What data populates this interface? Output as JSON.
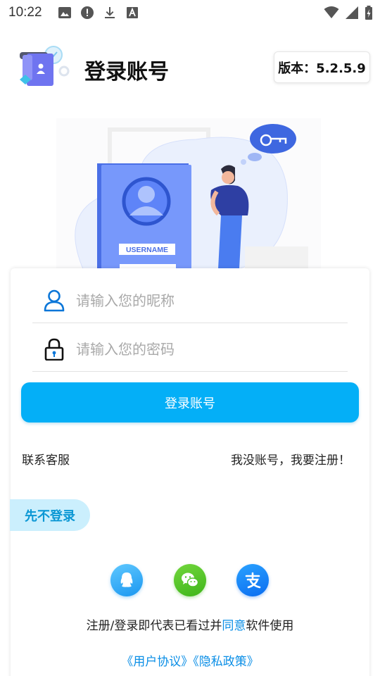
{
  "status_bar": {
    "time": "10:22",
    "icons_left": [
      "image-icon",
      "alert-icon",
      "download-icon",
      "font-icon"
    ],
    "icons_right": [
      "wifi-icon",
      "signal-icon",
      "battery-icon"
    ]
  },
  "header": {
    "title": "登录账号",
    "version": "版本：5.2.5.9"
  },
  "illustration": {
    "badge_label": "USERNAME"
  },
  "form": {
    "nickname_placeholder": "请输入您的昵称",
    "password_placeholder": "请输入您的密码",
    "login_button": "登录账号"
  },
  "links": {
    "contact": "联系客服",
    "register": "我没账号，我要注册！",
    "skip": "先不登录"
  },
  "social": [
    "qq-icon",
    "wechat-icon",
    "alipay-icon"
  ],
  "agreement": {
    "prefix": "注册/登录即代表已看过并",
    "highlight": "同意",
    "suffix": "软件使用",
    "user_agreement": "《用户协议》",
    "privacy_policy": "《隐私政策》"
  },
  "colors": {
    "accent": "#04aff7",
    "link": "#0a8ee6",
    "skip_bg": "#cbeffd",
    "illustration_blue": "#6b8ff7"
  }
}
